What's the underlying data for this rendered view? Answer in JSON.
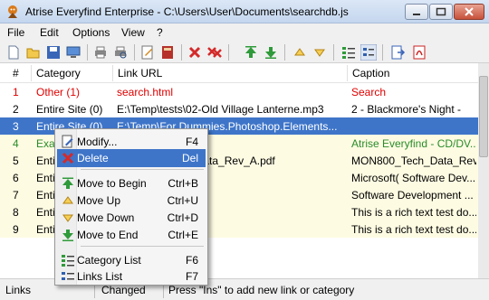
{
  "window": {
    "title": "Atrise Everyfind Enterprise - C:\\Users\\User\\Documents\\searchdb.js"
  },
  "menubar": {
    "items": [
      "File",
      "Edit",
      "Options",
      "View",
      "?"
    ]
  },
  "toolbar": {
    "icons": [
      "new-icon",
      "open-icon",
      "save-icon",
      "monitor-icon",
      "print-icon",
      "print-preview-icon",
      "edit-icon",
      "delete-book-icon",
      "delete-x-icon",
      "delete-all-icon",
      "move-top-icon",
      "move-bottom-icon",
      "move-up-icon",
      "move-down-icon",
      "category-list-icon",
      "links-list-icon",
      "export-icon",
      "pdf-icon"
    ]
  },
  "table": {
    "columns": [
      "#",
      "Category",
      "Link URL",
      "Caption"
    ],
    "rows": [
      {
        "num": "1",
        "category": "Other (1)",
        "url": "search.html",
        "caption": "Search",
        "style": "red"
      },
      {
        "num": "2",
        "category": "Entire Site (0)",
        "url": "E:\\Temp\\tests\\02-Old Village Lanterne.mp3",
        "caption": "2 - Blackmore's Night -",
        "style": "plain"
      },
      {
        "num": "3",
        "category": "Entire Site (0)",
        "url": "E:\\Temp\\For Dummies.Photoshop.Elements...",
        "caption": "",
        "style": "selected"
      },
      {
        "num": "4",
        "category": "Exar",
        "url": "com/everyfind/",
        "caption": "Atrise Everyfind - CD/DV...",
        "style": "green"
      },
      {
        "num": "5",
        "category": "Enti",
        "url": "MON800_Tech_Data_Rev_A.pdf",
        "caption": "MON800_Tech_Data_Rev_A...",
        "style": "plain"
      },
      {
        "num": "6",
        "category": "Enti",
        "url": "32.DOC",
        "caption": "Microsoft( Software Dev...",
        "style": "plain"
      },
      {
        "num": "7",
        "category": "Enti",
        "url": "32.rtf",
        "caption": "Software Development ...",
        "style": "plain"
      },
      {
        "num": "8",
        "category": "Enti",
        "url": ".doc",
        "caption": "This is a rich text test do...",
        "style": "plain"
      },
      {
        "num": "9",
        "category": "Enti",
        "url": ".doc",
        "caption": "This is a rich text test do...",
        "style": "plain"
      }
    ]
  },
  "context_menu": {
    "items": [
      {
        "label": "Modify...",
        "shortcut": "F4",
        "icon": "modify-icon"
      },
      {
        "label": "Delete",
        "shortcut": "Del",
        "icon": "delete-icon"
      },
      {
        "label": "Move to Begin",
        "shortcut": "Ctrl+B",
        "icon": "move-begin-icon"
      },
      {
        "label": "Move Up",
        "shortcut": "Ctrl+U",
        "icon": "move-up-icon"
      },
      {
        "label": "Move Down",
        "shortcut": "Ctrl+D",
        "icon": "move-down-icon"
      },
      {
        "label": "Move to End",
        "shortcut": "Ctrl+E",
        "icon": "move-end-icon"
      },
      {
        "label": "Category List",
        "shortcut": "F6",
        "icon": "category-list-icon"
      },
      {
        "label": "Links List",
        "shortcut": "F7",
        "icon": "links-list-icon"
      }
    ]
  },
  "statusbar": {
    "left": "Links",
    "middle": "Changed",
    "right": "Press \"Ins\" to add new link or category"
  },
  "colors": {
    "selection": "#3e75c9",
    "row_highlight": "#fdfbe2",
    "red_text": "#e00000",
    "green_text": "#2a8c2a"
  }
}
